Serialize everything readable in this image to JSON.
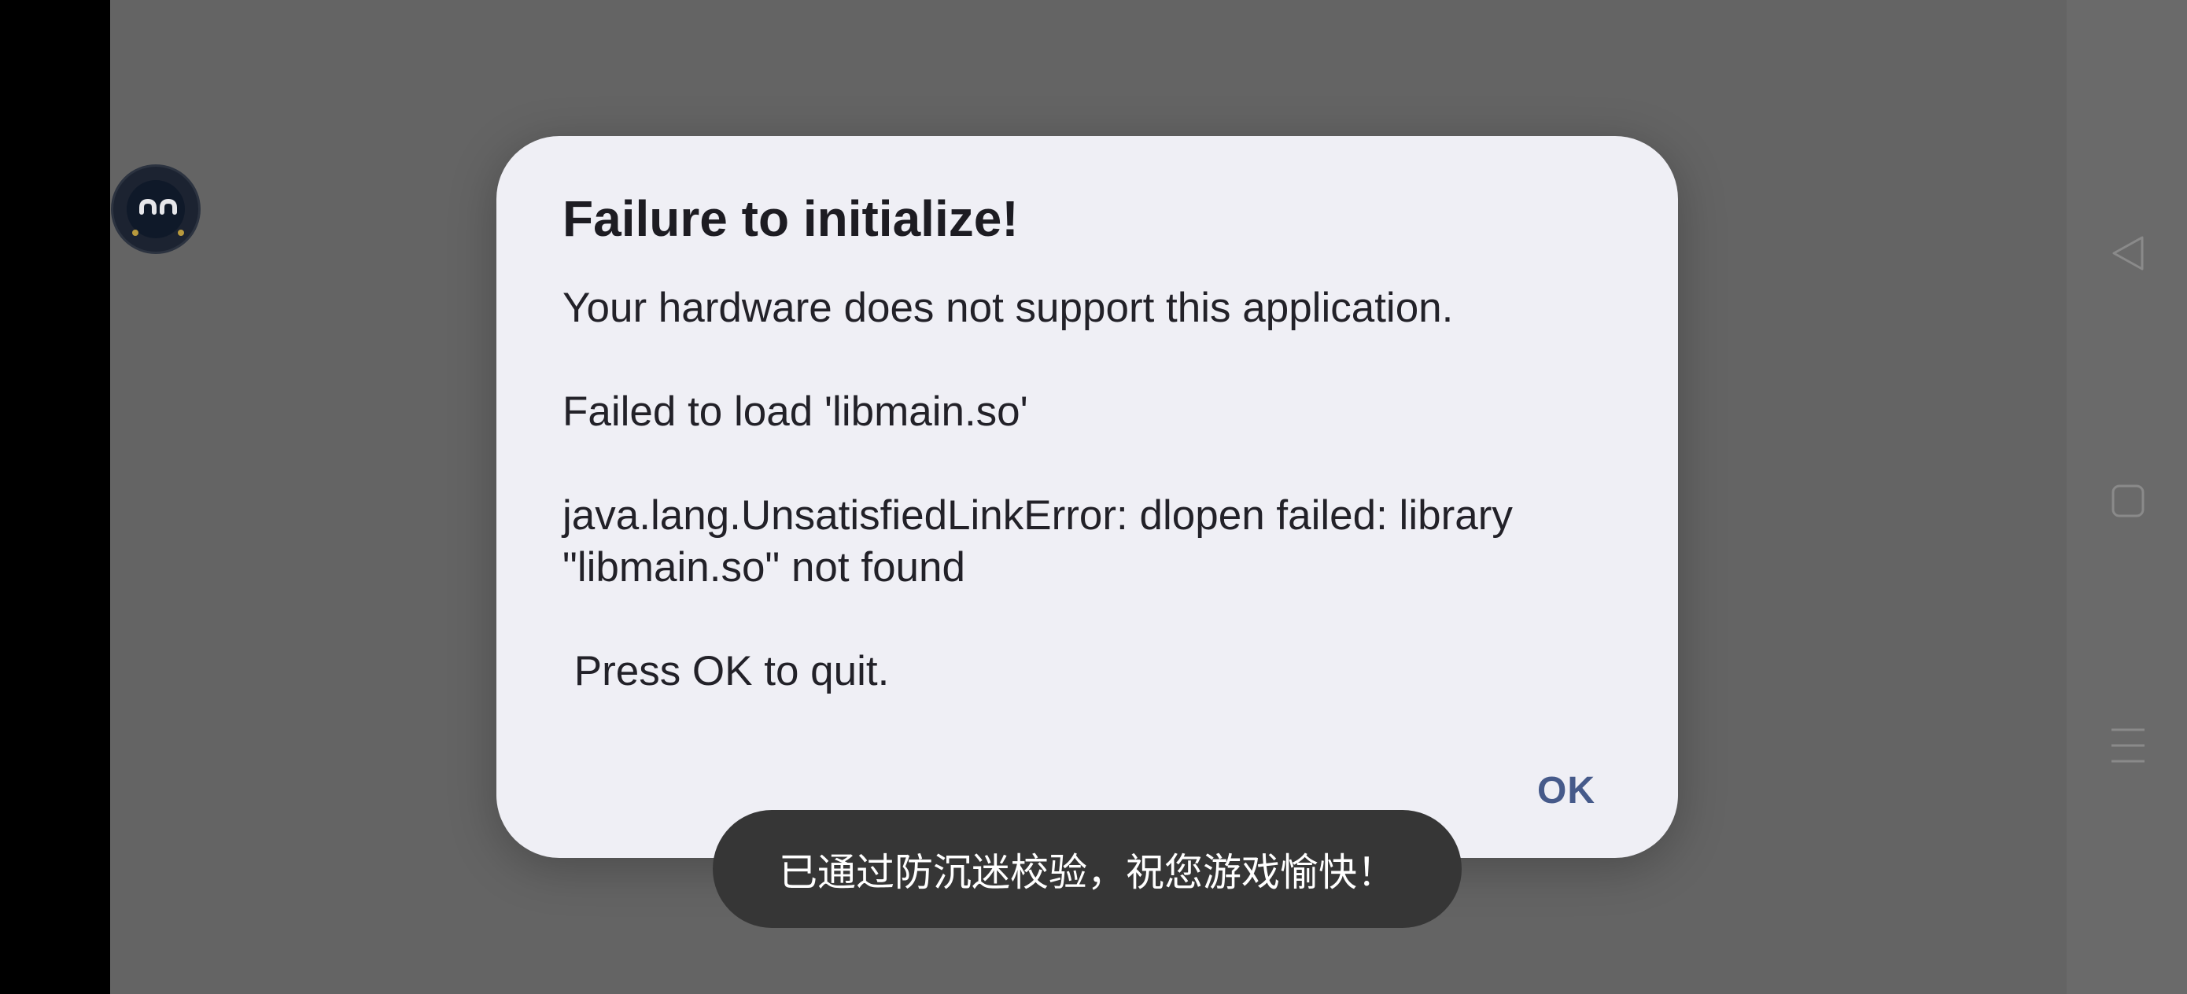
{
  "dialog": {
    "title": "Failure to initialize!",
    "message_line1": "Your hardware does not support this application.",
    "message_line2": "Failed to load 'libmain.so'",
    "message_line3a": "java.lang.UnsatisfiedLinkError: dlopen failed: library",
    "message_line3b": "\"libmain.so\" not found",
    "message_line4": " Press OK to quit.",
    "ok_label": "OK"
  },
  "toast": {
    "text": "已通过防沉迷校验，祝您游戏愉快！"
  },
  "floating_avatar": {
    "icon": "smiling-face-icon"
  },
  "navigation": {
    "back_icon": "back-triangle-icon",
    "home_icon": "home-square-icon",
    "recents_icon": "menu-lines-icon"
  },
  "colors": {
    "scrim": "#646464",
    "dialog_bg": "#efeff5",
    "accent": "#465a8a",
    "toast_bg": "#363636"
  }
}
